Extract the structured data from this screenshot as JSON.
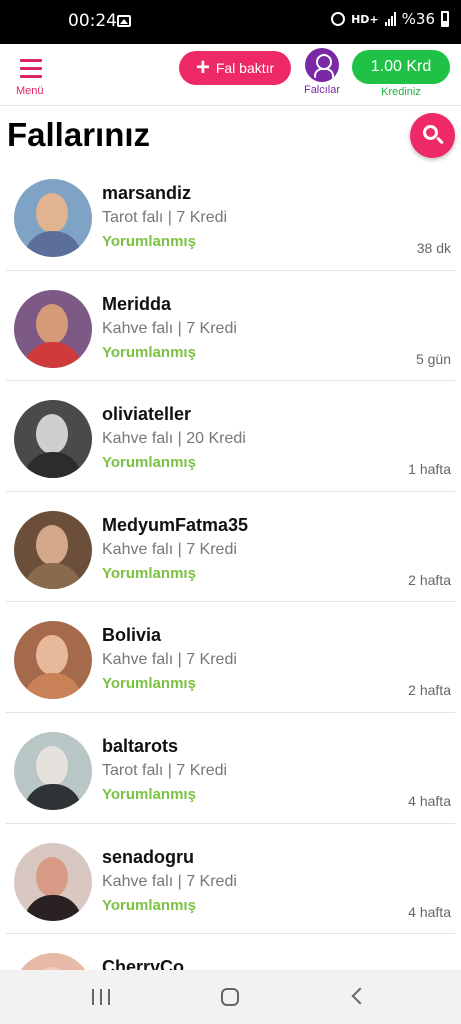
{
  "status_bar": {
    "time": "00:24",
    "network": "HD+",
    "battery": "%36"
  },
  "header": {
    "menu_label": "Menü",
    "fal_button_label": "Fal baktır",
    "falcilar_label": "Falcılar",
    "credit_value": "1.00 Krd",
    "credit_label": "Krediniz"
  },
  "page_title": "Fallarınız",
  "readings": [
    {
      "name": "marsandiz",
      "meta": "Tarot falı | 7 Kredi",
      "status": "Yorumlanmış",
      "time": "38 dk",
      "avatar_bg": "#7fa3c4",
      "avatar_face": "#e1b48f",
      "avatar_body": "#5c6e9c"
    },
    {
      "name": "Meridda",
      "meta": "Kahve falı | 7 Kredi",
      "status": "Yorumlanmış",
      "time": "5 gün",
      "avatar_bg": "#7d5a86",
      "avatar_face": "#d59a78",
      "avatar_body": "#cf3b3b"
    },
    {
      "name": "oliviateller",
      "meta": "Kahve falı | 20 Kredi",
      "status": "Yorumlanmış",
      "time": "1 hafta",
      "avatar_bg": "#4a4a4a",
      "avatar_face": "#cfcfcf",
      "avatar_body": "#2c2c2c"
    },
    {
      "name": "MedyumFatma35",
      "meta": "Kahve falı | 7 Kredi",
      "status": "Yorumlanmış",
      "time": "2 hafta",
      "avatar_bg": "#6b4f3a",
      "avatar_face": "#d3a88a",
      "avatar_body": "#8a6a4c"
    },
    {
      "name": "Bolivia",
      "meta": "Kahve falı | 7 Kredi",
      "status": "Yorumlanmış",
      "time": "2 hafta",
      "avatar_bg": "#a56a4c",
      "avatar_face": "#e8b89a",
      "avatar_body": "#c98258"
    },
    {
      "name": "baltarots",
      "meta": "Tarot falı | 7 Kredi",
      "status": "Yorumlanmış",
      "time": "4 hafta",
      "avatar_bg": "#b8c7c5",
      "avatar_face": "#e5e1dc",
      "avatar_body": "#2f3336"
    },
    {
      "name": "senadogru",
      "meta": "Kahve falı | 7 Kredi",
      "status": "Yorumlanmış",
      "time": "4 hafta",
      "avatar_bg": "#d9c7c2",
      "avatar_face": "#d79b86",
      "avatar_body": "#2a2222"
    },
    {
      "name": "CherryCo",
      "meta": "",
      "status": "",
      "time": "",
      "avatar_bg": "#e9b9a7",
      "avatar_face": "#f1cbbb",
      "avatar_body": "#c88a76"
    }
  ],
  "colors": {
    "brand_pink": "#ee2a66",
    "purple": "#7a28a6",
    "green": "#1fc247",
    "status_green": "#7cc242"
  }
}
